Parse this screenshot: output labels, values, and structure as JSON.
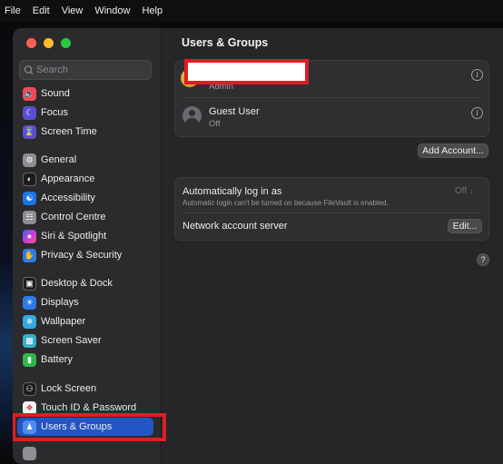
{
  "menubar": {
    "items": [
      "File",
      "Edit",
      "View",
      "Window",
      "Help"
    ]
  },
  "window": {
    "traffic_lights": {
      "close": "#ff5f57",
      "minimize": "#febc2e",
      "zoom": "#28c840"
    }
  },
  "sidebar": {
    "search_placeholder": "Search",
    "items": [
      {
        "label": "Sound",
        "icon": "speaker-icon",
        "color": "#ef4a5a"
      },
      {
        "label": "Focus",
        "icon": "moon-icon",
        "color": "#5a4fd0"
      },
      {
        "label": "Screen Time",
        "icon": "hourglass-icon",
        "color": "#5a4fd0"
      },
      {
        "label": "General",
        "icon": "gear-icon",
        "color": "#8e8e93"
      },
      {
        "label": "Appearance",
        "icon": "appearance-icon",
        "color": "#1c1c1e"
      },
      {
        "label": "Accessibility",
        "icon": "accessibility-icon",
        "color": "#1f74e8"
      },
      {
        "label": "Control Centre",
        "icon": "toggles-icon",
        "color": "#8e8e93"
      },
      {
        "label": "Siri & Spotlight",
        "icon": "siri-icon",
        "color": "#c93bd8"
      },
      {
        "label": "Privacy & Security",
        "icon": "hand-icon",
        "color": "#2f7ae8"
      },
      {
        "label": "Desktop & Dock",
        "icon": "dock-icon",
        "color": "#1c1c1e"
      },
      {
        "label": "Displays",
        "icon": "sun-icon",
        "color": "#2f7ae8"
      },
      {
        "label": "Wallpaper",
        "icon": "snowflake-icon",
        "color": "#35a8e0"
      },
      {
        "label": "Screen Saver",
        "icon": "screensaver-icon",
        "color": "#36b0c8"
      },
      {
        "label": "Battery",
        "icon": "battery-icon",
        "color": "#2fb84a"
      },
      {
        "label": "Lock Screen",
        "icon": "lock-icon",
        "color": "#1c1c1e"
      },
      {
        "label": "Touch ID & Password",
        "icon": "fingerprint-icon",
        "color": "#f2f2f2"
      },
      {
        "label": "Users & Groups",
        "icon": "users-icon",
        "color": "#2f7ae8"
      }
    ]
  },
  "main": {
    "title": "Users & Groups",
    "users": [
      {
        "name": "",
        "role": "Admin"
      },
      {
        "name": "Guest User",
        "role": "Off"
      }
    ],
    "add_account_label": "Add Account...",
    "auto_login": {
      "label": "Automatically log in as",
      "note": "Automatic login can't be turned on because FileVault is enabled.",
      "value": "Off"
    },
    "network_server": {
      "label": "Network account server",
      "edit_label": "Edit..."
    },
    "help_label": "?"
  }
}
